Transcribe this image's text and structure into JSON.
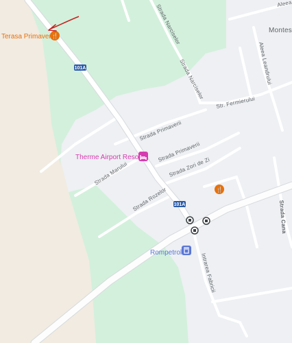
{
  "colors": {
    "background": "#eef0f3",
    "sand": "#f1ebe1",
    "green": "#d3f0dc",
    "road": "#ffffff",
    "road_major": "#fdfdfd",
    "road_casing": "#d6d9dd",
    "label": "#5f6368",
    "restaurant": "#e8710a",
    "hotel": "#d63cb0",
    "gas": "#5b77d6",
    "transit": "#3c4043",
    "shield": "#2a5aa8",
    "arrow": "#c5221f"
  },
  "pois": {
    "restaurant_main": {
      "name": "Terasa Primaverii",
      "icon": "restaurant-icon"
    },
    "restaurant_east": {
      "icon": "restaurant-icon"
    },
    "hotel": {
      "name": "Therme Airport Resort",
      "icon": "hotel-bed-icon"
    },
    "gas_station": {
      "name": "Rompetrol",
      "icon": "gas-station-icon"
    },
    "bus_stops": [
      {
        "icon": "bus-stop-icon"
      },
      {
        "icon": "bus-stop-icon"
      },
      {
        "icon": "bus-stop-icon"
      }
    ]
  },
  "road_shields": [
    "101A",
    "101A"
  ],
  "streets": {
    "aleea_top": "Aleea",
    "montess": "Montess",
    "strada_narcisei_a": "Strada Narciselor",
    "strada_narcisei_b": "Strada Narciselor",
    "aleea_leandrului": "Aleea Leandrului",
    "str_fermierului": "Str. Fermierului",
    "strada_primaverii_a": "Strada Primaverii",
    "strada_primaverii_b": "Strada Primaverii",
    "strada_marului": "Strada Marului",
    "strada_zori": "Strada Zori de Zi",
    "strada_rozelor": "Strada Rozelor",
    "strada_canal": "Strada Cana",
    "intrarea_fabricii": "Intrarea Fabricii"
  },
  "annotation": {
    "type": "arrow",
    "points_to": "Terasa Primaverii"
  }
}
